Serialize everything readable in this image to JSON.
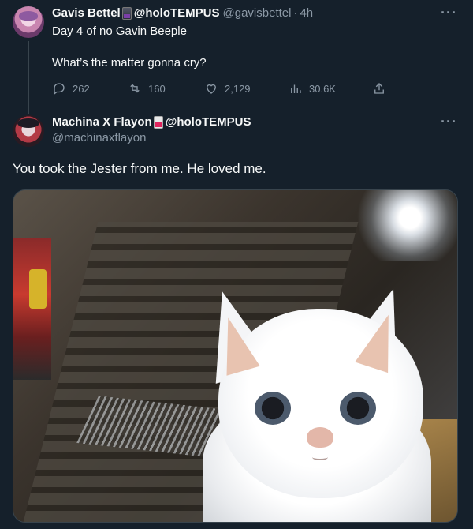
{
  "parent_tweet": {
    "display_name": "Gavis Bettel",
    "org_handle": "@holoTEMPUS",
    "handle": "@gavisbettel",
    "separator": "·",
    "time": "4h",
    "line1": "Day 4 of no Gavin Beeple",
    "line2": "What’s the matter gonna cry?",
    "stats": {
      "replies": "262",
      "retweets": "160",
      "likes": "2,129",
      "views": "30.6K"
    }
  },
  "reply_tweet": {
    "display_name": "Machina X Flayon",
    "org_handle": "@holoTEMPUS",
    "handle": "@machinaxflayon",
    "text": "You took the Jester from me. He loved me."
  },
  "more_label": "···",
  "icons": {
    "reply": "reply-icon",
    "retweet": "retweet-icon",
    "like": "heart-icon",
    "views": "views-icon",
    "share": "share-icon"
  },
  "colors": {
    "background": "#15202b",
    "text": "#f7f9f9",
    "secondary": "#8b98a5",
    "divider": "#38444d"
  }
}
